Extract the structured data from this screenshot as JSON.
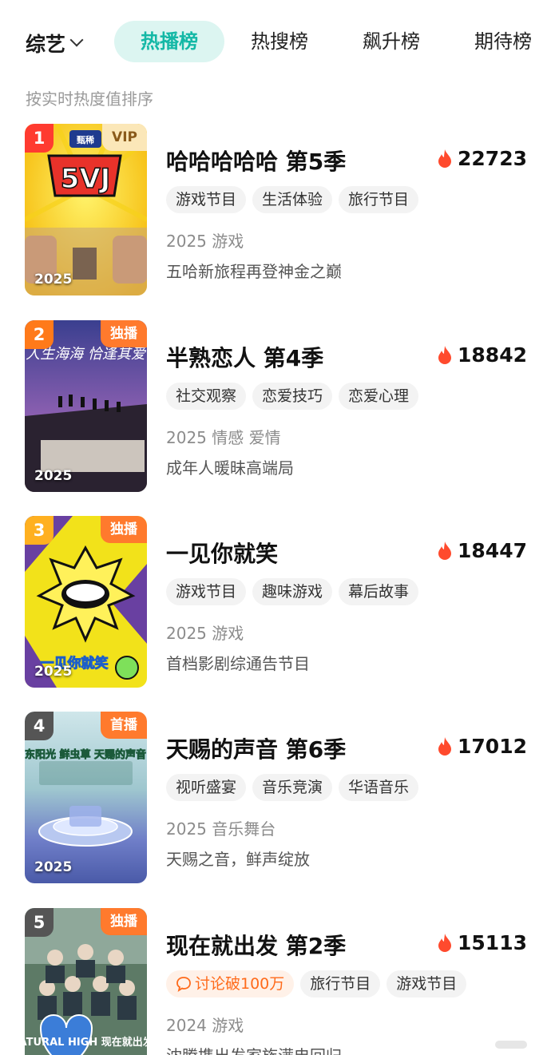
{
  "header": {
    "category": "综艺",
    "tabs": [
      {
        "label": "热播榜",
        "active": true
      },
      {
        "label": "热搜榜",
        "active": false
      },
      {
        "label": "飙升榜",
        "active": false
      },
      {
        "label": "期待榜",
        "active": false
      }
    ],
    "subtitle": "按实时热度值排序"
  },
  "items": [
    {
      "rank": "1",
      "badge": "VIP",
      "year_overlay": "2025",
      "title": "哈哈哈哈哈 第5季",
      "heat": "22723",
      "tags": [
        "游戏节目",
        "生活体验",
        "旅行节目"
      ],
      "meta": "2025 游戏",
      "desc": "五哈新旅程再登神金之巅",
      "poster_art": "5VJ",
      "rank_color": "#ff3b30"
    },
    {
      "rank": "2",
      "badge": "独播",
      "year_overlay": "2025",
      "title": "半熟恋人 第4季",
      "heat": "18842",
      "tags": [
        "社交观察",
        "恋爱技巧",
        "恋爱心理"
      ],
      "meta": "2025 情感 爱情",
      "desc": "成年人暖昧高端局",
      "poster_art": "人生海海 恰逢其爱",
      "rank_color": "#ff7a1a"
    },
    {
      "rank": "3",
      "badge": "独播",
      "year_overlay": "2025",
      "title": "一见你就笑",
      "heat": "18447",
      "tags": [
        "游戏节目",
        "趣味游戏",
        "幕后故事"
      ],
      "meta": "2025 游戏",
      "desc": "首档影剧综通告节目",
      "poster_art": "一见你就笑",
      "rank_color": "#ffb020"
    },
    {
      "rank": "4",
      "badge": "首播",
      "year_overlay": "2025",
      "title": "天赐的声音 第6季",
      "heat": "17012",
      "tags": [
        "视听盛宴",
        "音乐竞演",
        "华语音乐"
      ],
      "meta": "2025 音乐舞台",
      "desc": "天赐之音，鲜声绽放",
      "poster_art": "东阳光 鲜虫草 天赐的声音",
      "rank_color": "#555555"
    },
    {
      "rank": "5",
      "badge": "独播",
      "year_overlay": "",
      "title": "现在就出发 第2季",
      "heat": "15113",
      "tags": [
        "讨论破100万",
        "旅行节目",
        "游戏节目"
      ],
      "hot_tag": true,
      "meta": "2024 游戏",
      "desc": "沈腾携出发家族满电回归",
      "poster_art": "纯甄 NATURAL HIGH 现在就出发",
      "rank_color": "#555555"
    }
  ]
}
